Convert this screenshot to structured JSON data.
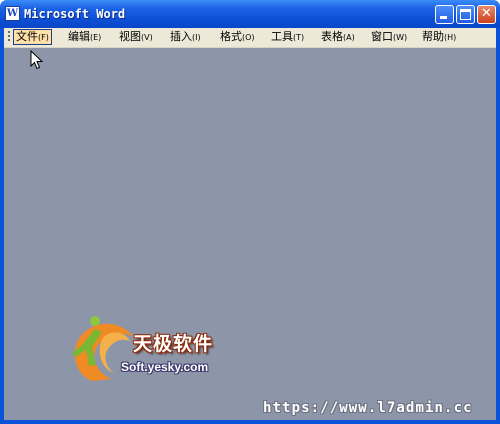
{
  "window": {
    "title": "Microsoft Word",
    "icon_letter": "W",
    "colors": {
      "titlebar": "#0c4fd6",
      "client": "#8d96a8",
      "menubar": "#ece9d8",
      "close": "#c9431d"
    }
  },
  "menubar": {
    "items": [
      {
        "label": "文件",
        "accel": "(F)",
        "active": true
      },
      {
        "label": "编辑",
        "accel": "(E)"
      },
      {
        "label": "视图",
        "accel": "(V)"
      },
      {
        "label": "插入",
        "accel": "(I)"
      },
      {
        "label": "格式",
        "accel": "(O)"
      },
      {
        "label": "工具",
        "accel": "(T)"
      },
      {
        "label": "表格",
        "accel": "(A)"
      },
      {
        "label": "窗口",
        "accel": "(W)"
      },
      {
        "label": "帮助",
        "accel": "(H)"
      }
    ]
  },
  "logo": {
    "cn": "天极软件",
    "en": "Soft.yesky.com"
  },
  "watermark": {
    "text": "https://www.l7admin.cc"
  },
  "icons": [
    "word-app-icon",
    "minimize-icon",
    "maximize-icon",
    "close-icon",
    "mouse-cursor-icon",
    "yesky-logo"
  ]
}
